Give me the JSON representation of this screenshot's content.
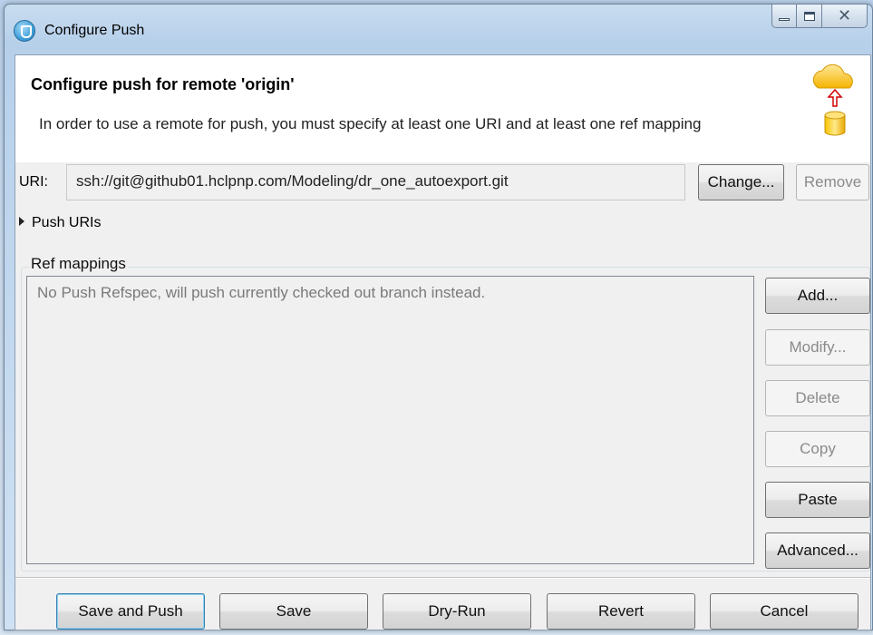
{
  "window": {
    "title": "Configure Push"
  },
  "header": {
    "title": "Configure push for remote 'origin'",
    "description": "In order to use a remote for push, you must specify at least one URI and at least one ref mapping"
  },
  "uri": {
    "label": "URI:",
    "value": "ssh://git@github01.hclpnp.com/Modeling/dr_one_autoexport.git",
    "change_label": "Change...",
    "remove_label": "Remove"
  },
  "push_uris": {
    "label": "Push URIs",
    "expanded": false
  },
  "ref_mappings": {
    "legend": "Ref mappings",
    "empty_text": "No Push Refspec, will push currently checked out branch instead.",
    "buttons": {
      "add": "Add...",
      "modify": "Modify...",
      "delete": "Delete",
      "copy": "Copy",
      "paste": "Paste",
      "advanced": "Advanced..."
    }
  },
  "footer": {
    "save_and_push": "Save and Push",
    "save": "Save",
    "dry_run": "Dry-Run",
    "revert": "Revert",
    "cancel": "Cancel"
  },
  "colors": {
    "default_button_border": "#3c7fb1",
    "disabled_text": "#8a8a8a",
    "window_frame": "#b7d0ea"
  },
  "icons": {
    "app": "eclipse-egit-icon",
    "wizard": "cloud-push-database-icon"
  }
}
